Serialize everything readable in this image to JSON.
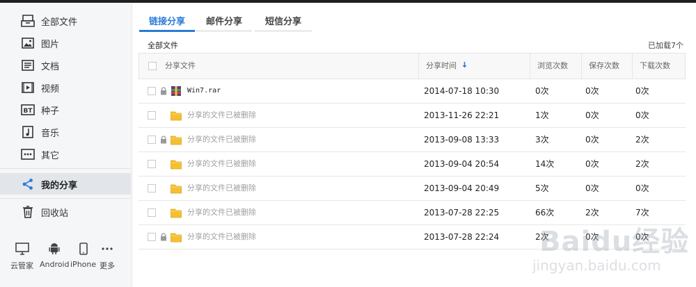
{
  "sidebar": {
    "items": [
      {
        "label": "全部文件",
        "icon": "cabinet-icon"
      },
      {
        "label": "图片",
        "icon": "image-icon"
      },
      {
        "label": "文档",
        "icon": "document-icon"
      },
      {
        "label": "视频",
        "icon": "video-icon"
      },
      {
        "label": "种子",
        "icon": "bt-icon"
      },
      {
        "label": "音乐",
        "icon": "music-icon"
      },
      {
        "label": "其它",
        "icon": "other-icon"
      },
      {
        "label": "我的分享",
        "icon": "share-icon"
      },
      {
        "label": "回收站",
        "icon": "trash-icon"
      }
    ],
    "devices": [
      {
        "label": "云管家",
        "icon": "monitor-icon"
      },
      {
        "label": "Android",
        "icon": "android-icon"
      },
      {
        "label": "iPhone",
        "icon": "iphone-icon"
      },
      {
        "label": "更多",
        "icon": "more-icon"
      }
    ]
  },
  "tabs": [
    {
      "label": "链接分享",
      "active": true
    },
    {
      "label": "邮件分享",
      "active": false
    },
    {
      "label": "短信分享",
      "active": false
    }
  ],
  "breadcrumb": "全部文件",
  "loaded_count": "已加载7个",
  "columns": {
    "file": "分享文件",
    "time": "分享时间",
    "views": "浏览次数",
    "saves": "保存次数",
    "downloads": "下载次数"
  },
  "rows": [
    {
      "name": "Win7.rar",
      "deleted": false,
      "locked": true,
      "time": "2014-07-18 10:30",
      "views": "0次",
      "saves": "0次",
      "downloads": "0次"
    },
    {
      "name": "分享的文件已被删除",
      "deleted": true,
      "locked": false,
      "time": "2013-11-26 22:21",
      "views": "1次",
      "saves": "0次",
      "downloads": "0次"
    },
    {
      "name": "分享的文件已被删除",
      "deleted": true,
      "locked": true,
      "time": "2013-09-08 13:33",
      "views": "3次",
      "saves": "0次",
      "downloads": "2次"
    },
    {
      "name": "分享的文件已被删除",
      "deleted": true,
      "locked": false,
      "time": "2013-09-04 20:54",
      "views": "14次",
      "saves": "0次",
      "downloads": "2次"
    },
    {
      "name": "分享的文件已被删除",
      "deleted": true,
      "locked": false,
      "time": "2013-09-04 20:49",
      "views": "5次",
      "saves": "0次",
      "downloads": "0次"
    },
    {
      "name": "分享的文件已被删除",
      "deleted": true,
      "locked": false,
      "time": "2013-07-28 22:25",
      "views": "66次",
      "saves": "2次",
      "downloads": "7次"
    },
    {
      "name": "分享的文件已被删除",
      "deleted": true,
      "locked": true,
      "time": "2013-07-28 22:24",
      "views": "2次",
      "saves": "0次",
      "downloads": "0次"
    }
  ],
  "watermark": {
    "brand": "Baidu经验",
    "url": "jingyan.baidu.com"
  },
  "colors": {
    "accent": "#2b7bd8",
    "folder": "#f4c032",
    "sidebar_bg": "#f5f6f8"
  }
}
